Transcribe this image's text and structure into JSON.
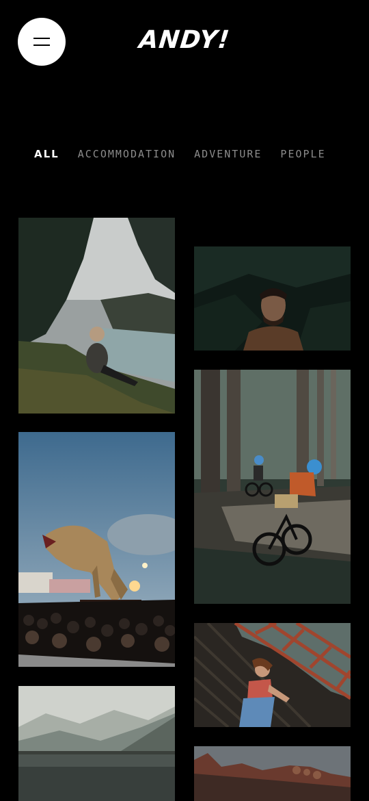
{
  "header": {
    "menu_icon": "hamburger-menu-icon",
    "logo_text": "ANDY!"
  },
  "filters": [
    {
      "label": "ALL",
      "active": true
    },
    {
      "label": "ACCOMMODATION",
      "active": false
    },
    {
      "label": "ADVENTURE",
      "active": false
    },
    {
      "label": "PEOPLE",
      "active": false
    }
  ],
  "colors": {
    "background": "#000000",
    "active_filter": "#ffffff",
    "inactive_filter": "#8c8c8c",
    "menu_button_bg": "#ffffff"
  }
}
